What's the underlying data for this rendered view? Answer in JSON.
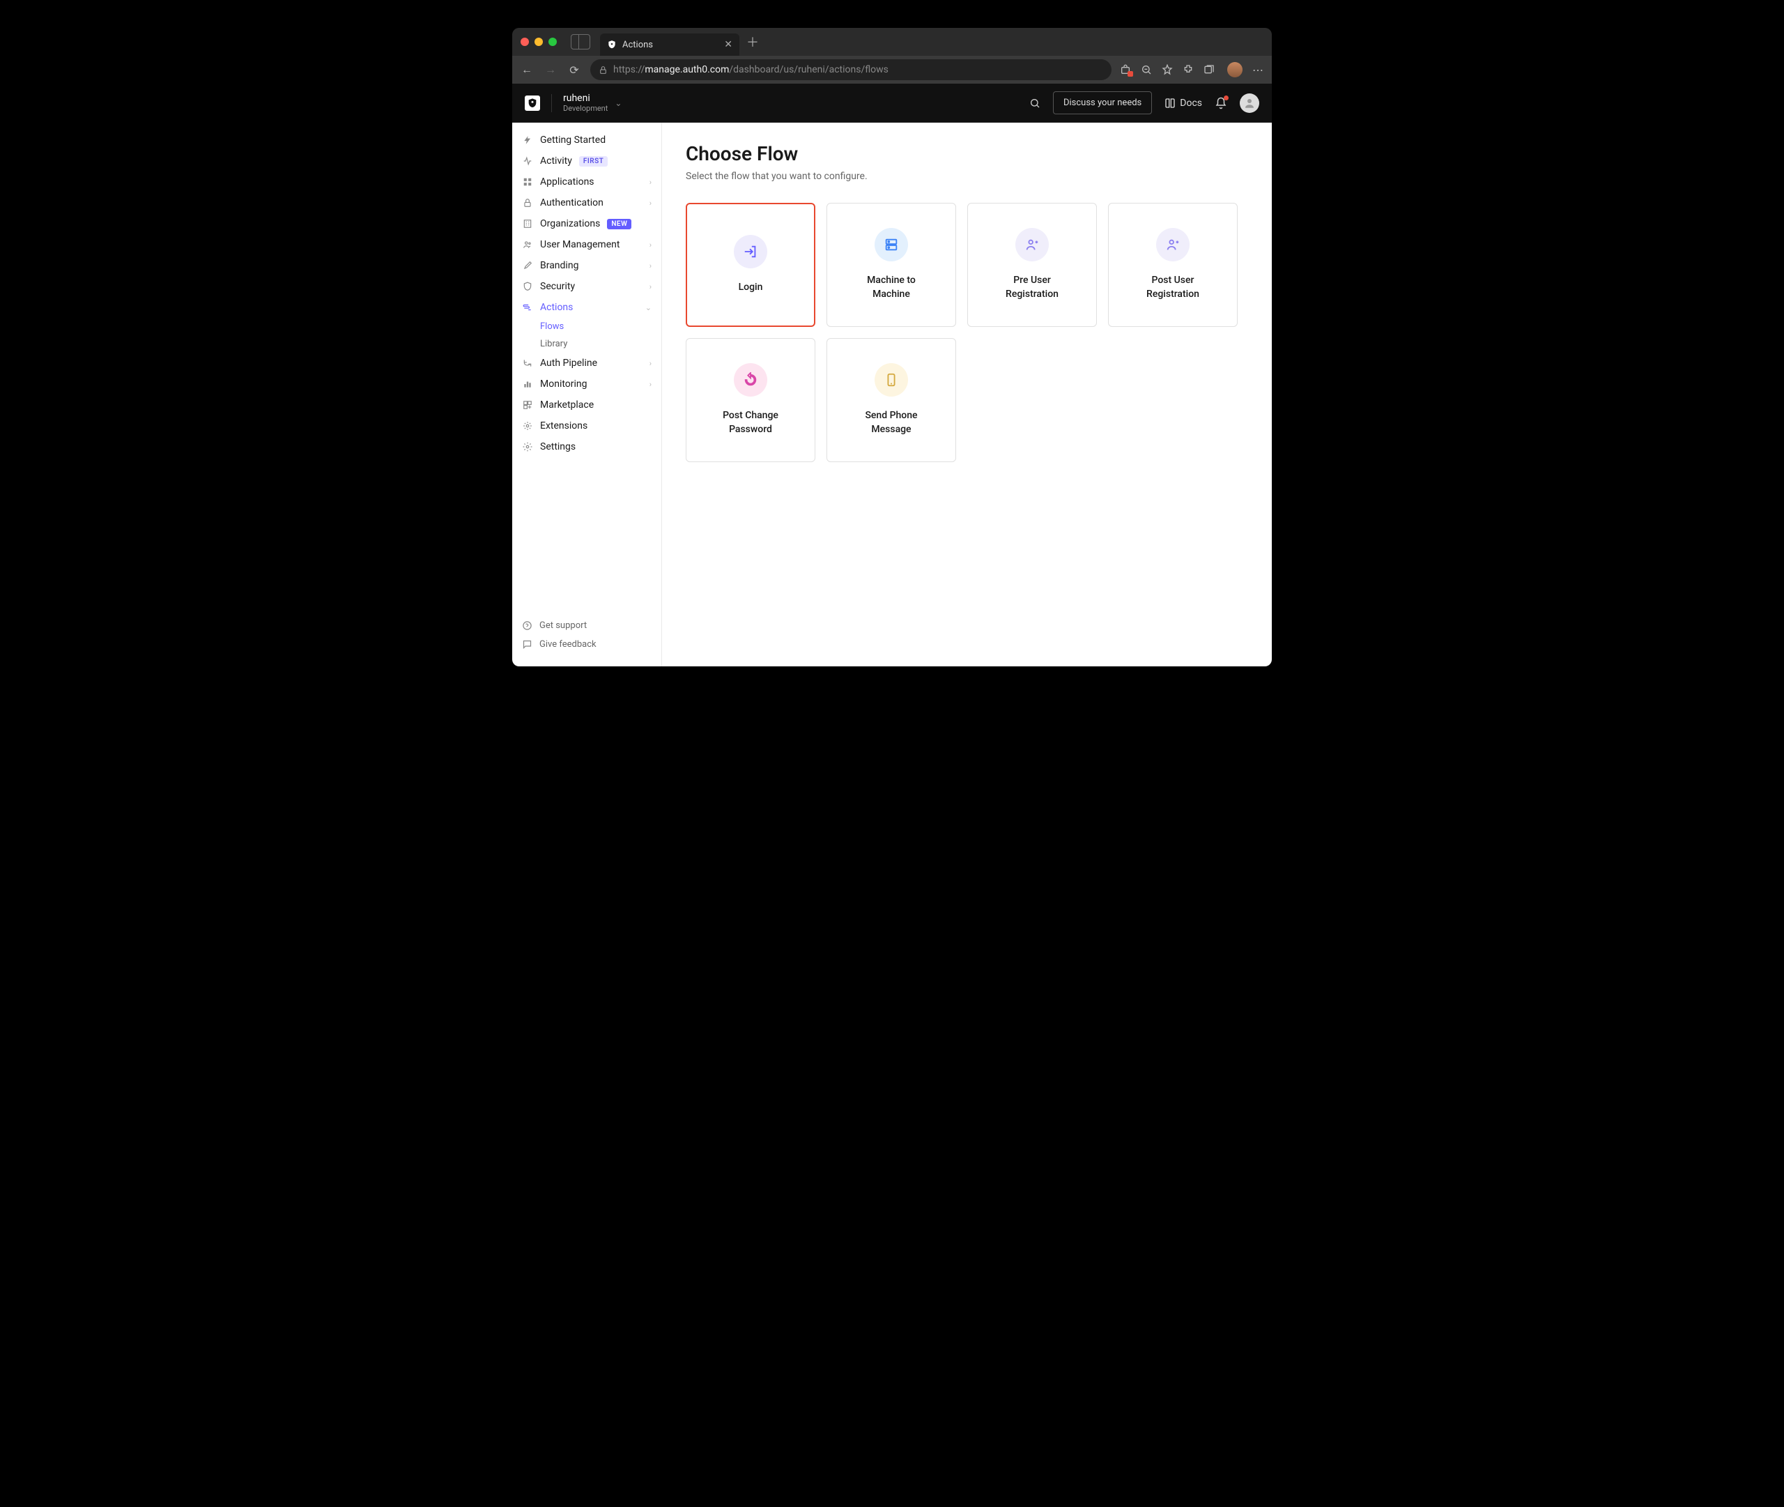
{
  "browser": {
    "tab_title": "Actions",
    "url_proto": "https://",
    "url_host": "manage.auth0.com",
    "url_path": "/dashboard/us/ruheni/actions/flows"
  },
  "header": {
    "tenant_name": "ruheni",
    "tenant_env": "Development",
    "discuss_label": "Discuss your needs",
    "docs_label": "Docs"
  },
  "sidebar": {
    "items": [
      {
        "label": "Getting Started"
      },
      {
        "label": "Activity",
        "badge": "FIRST"
      },
      {
        "label": "Applications",
        "chev": true
      },
      {
        "label": "Authentication",
        "chev": true
      },
      {
        "label": "Organizations",
        "badge_new": "NEW"
      },
      {
        "label": "User Management",
        "chev": true
      },
      {
        "label": "Branding",
        "chev": true
      },
      {
        "label": "Security",
        "chev": true
      },
      {
        "label": "Actions",
        "chev": true,
        "active": true
      },
      {
        "label": "Auth Pipeline",
        "chev": true
      },
      {
        "label": "Monitoring",
        "chev": true
      },
      {
        "label": "Marketplace"
      },
      {
        "label": "Extensions"
      },
      {
        "label": "Settings"
      }
    ],
    "actions_sub": [
      {
        "label": "Flows",
        "active": true
      },
      {
        "label": "Library"
      }
    ],
    "footer": {
      "support": "Get support",
      "feedback": "Give feedback"
    }
  },
  "main": {
    "title": "Choose Flow",
    "subtitle": "Select the flow that you want to configure.",
    "flows": [
      {
        "label": "Login",
        "highlight": true
      },
      {
        "label": "Machine to\nMachine"
      },
      {
        "label": "Pre User\nRegistration"
      },
      {
        "label": "Post User\nRegistration"
      },
      {
        "label": "Post Change\nPassword"
      },
      {
        "label": "Send Phone\nMessage"
      }
    ]
  }
}
